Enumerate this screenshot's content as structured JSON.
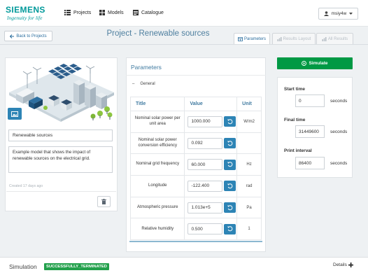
{
  "brand": {
    "name": "SIEMENS",
    "tagline": "Ingenuity for life"
  },
  "nav": {
    "items": [
      {
        "label": "Projects",
        "icon": "list-icon"
      },
      {
        "label": "Models",
        "icon": "grid-icon"
      },
      {
        "label": "Catalogue",
        "icon": "catalogue-icon"
      }
    ],
    "user": "msiy4w"
  },
  "subbar": {
    "back_label": "Back to Projects",
    "title": "Project - Renewable sources",
    "tabs": [
      {
        "label": "Parameters",
        "active": true
      },
      {
        "label": "Results Layout",
        "active": false
      },
      {
        "label": "All Results",
        "active": false
      }
    ]
  },
  "project": {
    "name": "Renewable sources",
    "description": "Example model that shows the impact of renewable sources on the electrical grid.",
    "created": "Created 17 days ago"
  },
  "parameters": {
    "title": "Parameters",
    "group": "General",
    "columns": [
      "Title",
      "Value",
      "Unit"
    ],
    "rows": [
      {
        "title": "Nominal solar power per unit area",
        "value": "1000.000",
        "unit": "W/m2"
      },
      {
        "title": "Nominal solar power conversion efficiency",
        "value": "0.092",
        "unit": ""
      },
      {
        "title": "Nominal grid frequency",
        "value": "60.000",
        "unit": "Hz"
      },
      {
        "title": "Longitude",
        "value": "-122.400",
        "unit": "rad"
      },
      {
        "title": "Atmospheric pressure",
        "value": "1.013e+5",
        "unit": "Pa"
      },
      {
        "title": "Relative humidity",
        "value": "0.500",
        "unit": "1"
      }
    ]
  },
  "simulate": {
    "button_label": "Simulate",
    "fields": [
      {
        "label": "Start time",
        "value": "0",
        "unit": "seconds"
      },
      {
        "label": "Final time",
        "value": "31449600",
        "unit": "seconds"
      },
      {
        "label": "Print interval",
        "value": "86400",
        "unit": "seconds"
      }
    ]
  },
  "footer": {
    "label": "Simulation",
    "status": "SUCCESSFULLY_TERMINATED",
    "details": "Details"
  },
  "colors": {
    "brand": "#00999a",
    "accent": "#2d84b5",
    "success": "#009944"
  }
}
